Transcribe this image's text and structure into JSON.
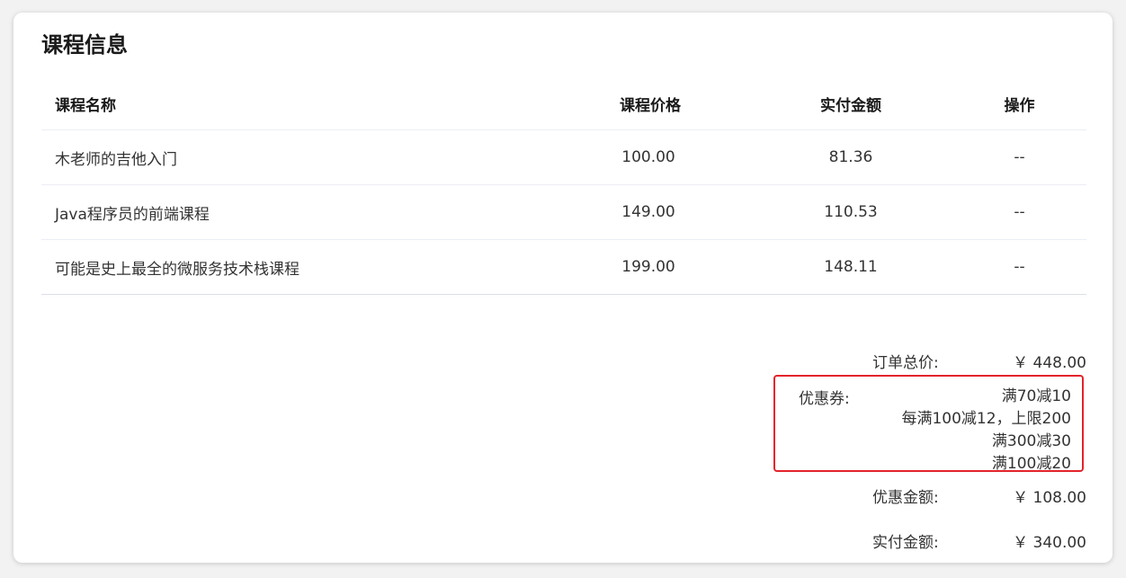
{
  "card_title": "课程信息",
  "table": {
    "headers": {
      "name": "课程名称",
      "price": "课程价格",
      "paid": "实付金额",
      "op": "操作"
    },
    "rows": [
      {
        "name": "木老师的吉他入门",
        "price": "100.00",
        "paid": "81.36",
        "op": "--"
      },
      {
        "name": "Java程序员的前端课程",
        "price": "149.00",
        "paid": "110.53",
        "op": "--"
      },
      {
        "name": "可能是史上最全的微服务技术栈课程",
        "price": "199.00",
        "paid": "148.11",
        "op": "--"
      }
    ]
  },
  "summary": {
    "total_label": "订单总价:",
    "total_value": "￥ 448.00",
    "coupon_label": "优惠券:",
    "coupons": [
      "满70减10",
      "每满100减12，上限200",
      "满300减30",
      "满100减20"
    ],
    "discount_label": "优惠金额:",
    "discount_value": "￥ 108.00",
    "paid_label": "实付金额:",
    "paid_value": "￥ 340.00"
  },
  "colors": {
    "highlight_border": "#e3242b"
  }
}
